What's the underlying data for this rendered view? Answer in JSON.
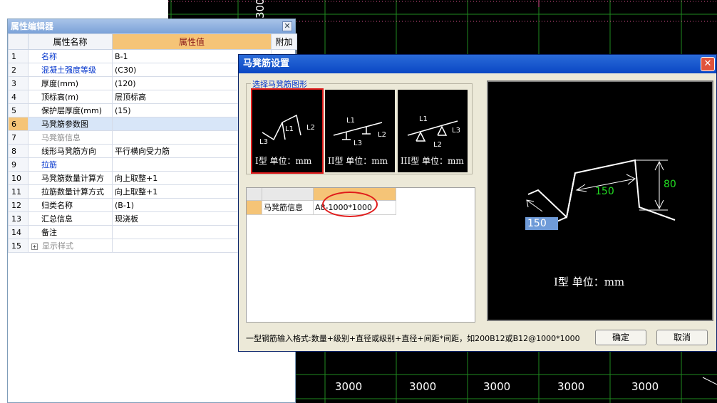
{
  "cad": {
    "top_label": "3000",
    "bottom_labels": [
      "3000",
      "3000",
      "3000",
      "3000",
      "3000"
    ],
    "colors": {
      "grid": "#1f8a1f",
      "pink": "#d94f8a"
    }
  },
  "prop_editor": {
    "title": "属性编辑器",
    "close_icon": "close-icon",
    "headers": {
      "name": "属性名称",
      "value": "属性值",
      "extra": "附加"
    },
    "rows": [
      {
        "idx": "1",
        "name": "名称",
        "value": "B-1",
        "style": "link"
      },
      {
        "idx": "2",
        "name": "混凝土强度等级",
        "value": "(C30)",
        "style": "link"
      },
      {
        "idx": "3",
        "name": "厚度(mm)",
        "value": "(120)",
        "style": "black"
      },
      {
        "idx": "4",
        "name": "顶标高(m)",
        "value": "层顶标高",
        "style": "black"
      },
      {
        "idx": "5",
        "name": "保护层厚度(mm)",
        "value": "(15)",
        "style": "black"
      },
      {
        "idx": "6",
        "name": "马凳筋参数图",
        "value": "",
        "style": "black",
        "selected": true
      },
      {
        "idx": "7",
        "name": "马凳筋信息",
        "value": "",
        "style": "grey"
      },
      {
        "idx": "8",
        "name": "线形马凳筋方向",
        "value": "平行横向受力筋",
        "style": "black"
      },
      {
        "idx": "9",
        "name": "拉筋",
        "value": "",
        "style": "link"
      },
      {
        "idx": "10",
        "name": "马凳筋数量计算方",
        "value": "向上取整+1",
        "style": "black"
      },
      {
        "idx": "11",
        "name": "拉筋数量计算方式",
        "value": "向上取整+1",
        "style": "black"
      },
      {
        "idx": "12",
        "name": "归类名称",
        "value": "(B-1)",
        "style": "black"
      },
      {
        "idx": "13",
        "name": "汇总信息",
        "value": "现浇板",
        "style": "black"
      },
      {
        "idx": "14",
        "name": "备注",
        "value": "",
        "style": "black"
      },
      {
        "idx": "15",
        "name": "显示样式",
        "value": "",
        "style": "grey",
        "expander": true
      }
    ]
  },
  "dialog": {
    "title": "马凳筋设置",
    "shape_group_label": "选择马凳筋图形",
    "shapes": [
      {
        "caption": "I型 单位：mm",
        "labels": [
          "L1",
          "L2",
          "L3"
        ]
      },
      {
        "caption": "II型 单位：mm",
        "labels": [
          "L1",
          "L2",
          "L3"
        ]
      },
      {
        "caption": "III型 单位：mm",
        "labels": [
          "L1",
          "L2",
          "L3"
        ]
      }
    ],
    "grid": {
      "row_label": "马凳筋信息",
      "value": "A8-1000*1000"
    },
    "preview": {
      "dim_150_top": "150",
      "dim_80": "80",
      "dim_150_selected": "150",
      "caption": "I型  单位：mm"
    },
    "format_hint": "一型钢筋输入格式:数量+级别+直径或级别+直径+间距*间距，如200B12或B12@1000*1000",
    "ok_label": "确定",
    "cancel_label": "取消"
  }
}
